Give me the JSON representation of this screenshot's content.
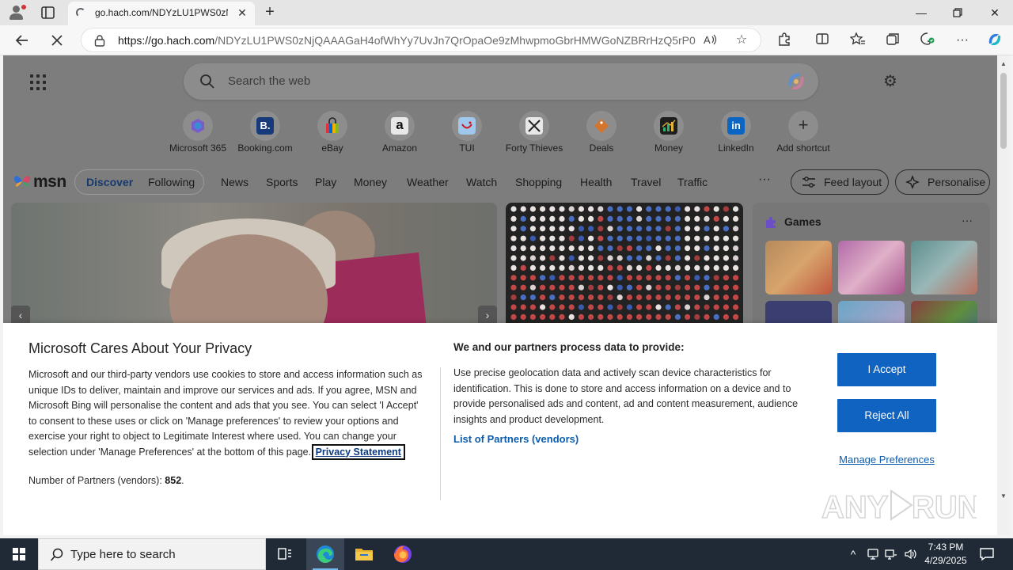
{
  "browser": {
    "tab_title": "go.hach.com/NDYzLU1PWS0zNjQ",
    "url_host": "https://go.hach.com",
    "url_path": "/NDYzLU1PWS0zNjQAAAGaH4ofWhYy7UvJn7QrOpaOe9zMhwpmoGbrHMWGoNZBRrHzQ5rP0..."
  },
  "msn": {
    "search_placeholder": "Search the web",
    "shortcuts": [
      {
        "label": "Microsoft 365",
        "color": "#7a5cc9",
        "glyph": ""
      },
      {
        "label": "Booking.com",
        "color": "#163a7a",
        "glyph": "B."
      },
      {
        "label": "eBay",
        "color": "#e53238",
        "glyph": ""
      },
      {
        "label": "Amazon",
        "color": "#f2f2f2",
        "glyph": "a"
      },
      {
        "label": "TUI",
        "color": "#7fb3e0",
        "glyph": ""
      },
      {
        "label": "Forty Thieves",
        "color": "#f0f0f0",
        "glyph": ""
      },
      {
        "label": "Deals",
        "color": "#d3752c",
        "glyph": ""
      },
      {
        "label": "Money",
        "color": "#2a2a2a",
        "glyph": ""
      },
      {
        "label": "LinkedIn",
        "color": "#0a66c2",
        "glyph": "in"
      },
      {
        "label": "Add shortcut",
        "color": "",
        "glyph": "+"
      }
    ],
    "logo_text": "msn",
    "tab_discover": "Discover",
    "tab_following": "Following",
    "nav_links": [
      "News",
      "Sports",
      "Play",
      "Money",
      "Weather",
      "Watch",
      "Shopping",
      "Health",
      "Travel",
      "Traffic"
    ],
    "nav_more": "···",
    "feed_layout": "Feed layout",
    "personalise": "Personalise",
    "games_title": "Games",
    "games_more": "···"
  },
  "privacy": {
    "title": "Microsoft Cares About Your Privacy",
    "body": "Microsoft and our third-party vendors use cookies to store and access information such as unique IDs to deliver, maintain and improve our services and ads. If you agree, MSN and Microsoft Bing will personalise the content and ads that you see. You can select 'I Accept' to consent to these uses or click on 'Manage preferences' to review your options and exercise your right to object to Legitimate Interest where used.  You can change your selection under 'Manage Preferences' at the bottom of this page.",
    "privacy_link": "Privacy Statement",
    "partners_label": "Number of Partners (vendors):",
    "partners_count": "852",
    "partners_suffix": ".",
    "subtitle": "We and our partners process data to provide:",
    "body2": "Use precise geolocation data and actively scan device characteristics for identification. This is done to store and access information on a device and to provide personalised ads and content, ad and content measurement, audience insights and product development.",
    "vendors_link": "List of Partners (vendors)",
    "accept": "I Accept",
    "reject": "Reject All",
    "manage": "Manage Preferences"
  },
  "taskbar": {
    "search_text": "Type here to search",
    "time": "7:43 PM",
    "date": "4/29/2025"
  }
}
